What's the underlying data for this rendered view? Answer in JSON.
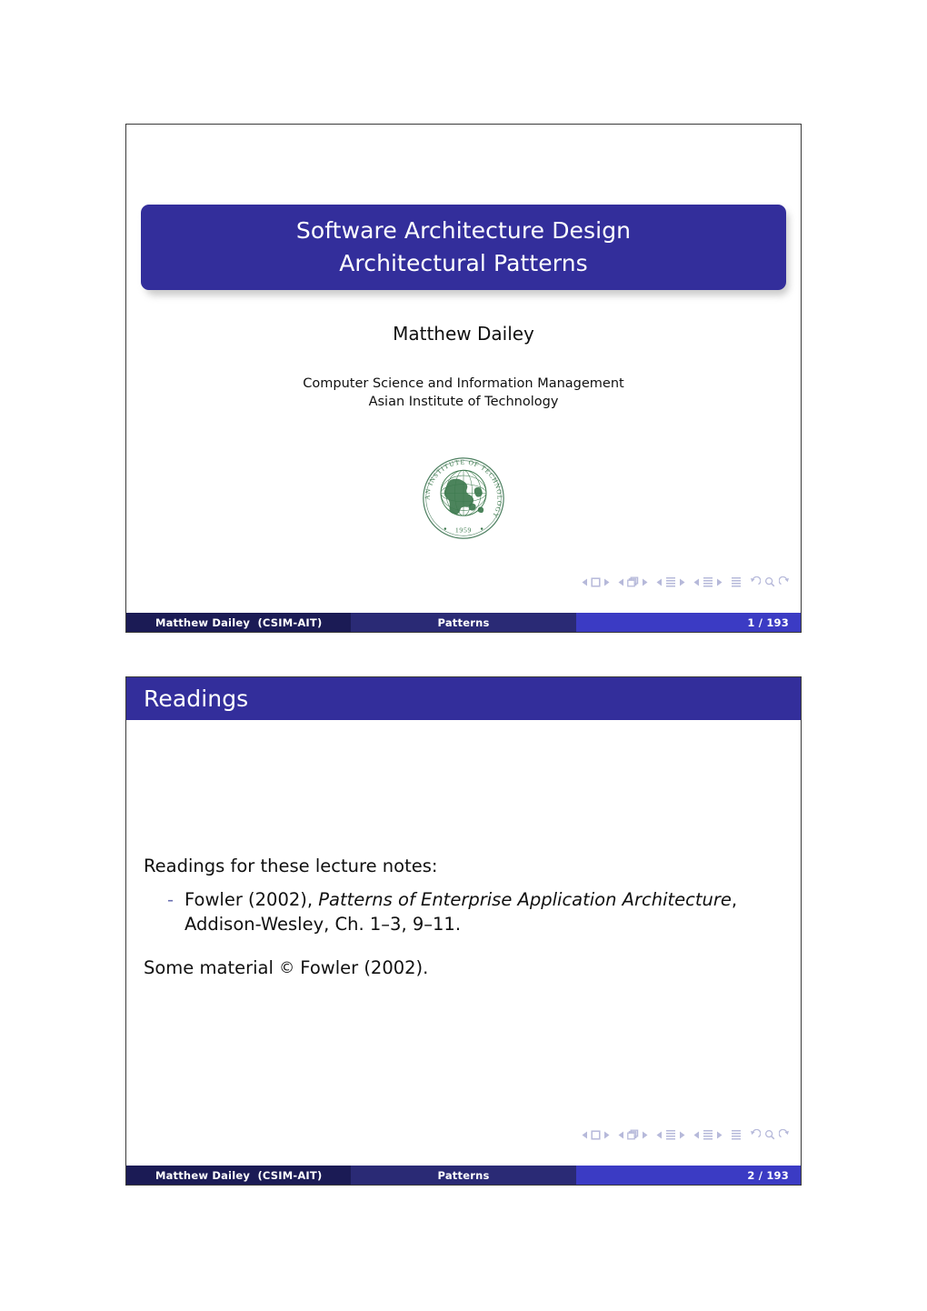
{
  "document": {
    "kind": "beamer-handout",
    "slide_count_visible": 2
  },
  "theme": {
    "block_blue": "#332e9b",
    "footer_left": "#1b1b55",
    "footer_mid": "#2a2a75",
    "footer_right": "#3b3bc4",
    "bullet_dash": "#6a6fb0",
    "logo_green": "#3d7a4e",
    "text": "#111111"
  },
  "slides": [
    {
      "id": "title-slide",
      "title_lines": [
        "Software Architecture Design",
        "Architectural Patterns"
      ],
      "author": "Matthew Dailey",
      "institution_lines": [
        "Computer Science and Information Management",
        "Asian Institute of Technology"
      ],
      "logo": {
        "name": "ait-seal-logo",
        "ring_text": "ASIAN INSTITUTE OF TECHNOLOGY",
        "year": "1959"
      },
      "footer": {
        "left": "Matthew Dailey  (CSIM-AIT)",
        "middle": "Patterns",
        "right": "1 / 193"
      }
    },
    {
      "id": "readings-slide",
      "frame_title": "Readings",
      "lead": "Readings for these lecture notes:",
      "bullets": [
        {
          "marker": "-",
          "pre": "Fowler (2002), ",
          "italic": "Patterns of Enterprise Application Architecture",
          "post": ", Addison-Wesley, Ch. 1–3, 9–11."
        }
      ],
      "paragraph_pre": "Some material ",
      "paragraph_symbol": "©",
      "paragraph_post": " Fowler (2002).",
      "footer": {
        "left": "Matthew Dailey  (CSIM-AIT)",
        "middle": "Patterns",
        "right": "2 / 193"
      }
    }
  ],
  "nav_symbols": {
    "items": [
      "prev-slide-icon",
      "slide-icon",
      "next-slide-icon",
      "prev-frame-icon",
      "frame-icon",
      "next-frame-icon",
      "prev-subsection-icon",
      "subsection-icon",
      "next-subsection-icon",
      "prev-section-icon",
      "section-icon",
      "next-section-icon",
      "toc-icon",
      "back-icon",
      "search-icon",
      "forward-icon"
    ]
  }
}
